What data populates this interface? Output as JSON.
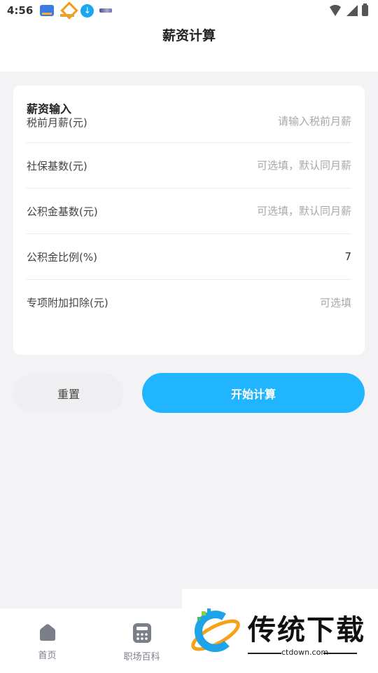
{
  "status_bar": {
    "time": "4:56",
    "app_icons": [
      "baidu-app-icon",
      "taobao-app-icon",
      "download-icon",
      "banner-app-icon"
    ],
    "right_icons": [
      "wifi-icon",
      "signal-icon",
      "battery-icon"
    ]
  },
  "header": {
    "title": "薪资计算"
  },
  "form": {
    "section_title": "薪资输入",
    "fields": [
      {
        "label": "税前月薪(元)",
        "value": "",
        "placeholder": "请输入税前月薪"
      },
      {
        "label": "社保基数(元)",
        "value": "",
        "placeholder": "可选填，默认同月薪"
      },
      {
        "label": "公积金基数(元)",
        "value": "",
        "placeholder": "可选填，默认同月薪"
      },
      {
        "label": "公积金比例(%)",
        "value": "7",
        "placeholder": ""
      },
      {
        "label": "专项附加扣除(元)",
        "value": "",
        "placeholder": "可选填"
      }
    ]
  },
  "actions": {
    "reset_label": "重置",
    "calculate_label": "开始计算"
  },
  "tabbar": {
    "tabs": [
      {
        "label": "首页",
        "icon": "home-icon"
      },
      {
        "label": "职场百科",
        "icon": "calculator-icon"
      }
    ]
  },
  "watermark": {
    "brand": "传统下载",
    "url": "ctdown.com"
  },
  "colors": {
    "accent": "#22b5ff",
    "background": "#f3f3f5",
    "card": "#ffffff",
    "tab_icon": "#7a7f8a"
  }
}
